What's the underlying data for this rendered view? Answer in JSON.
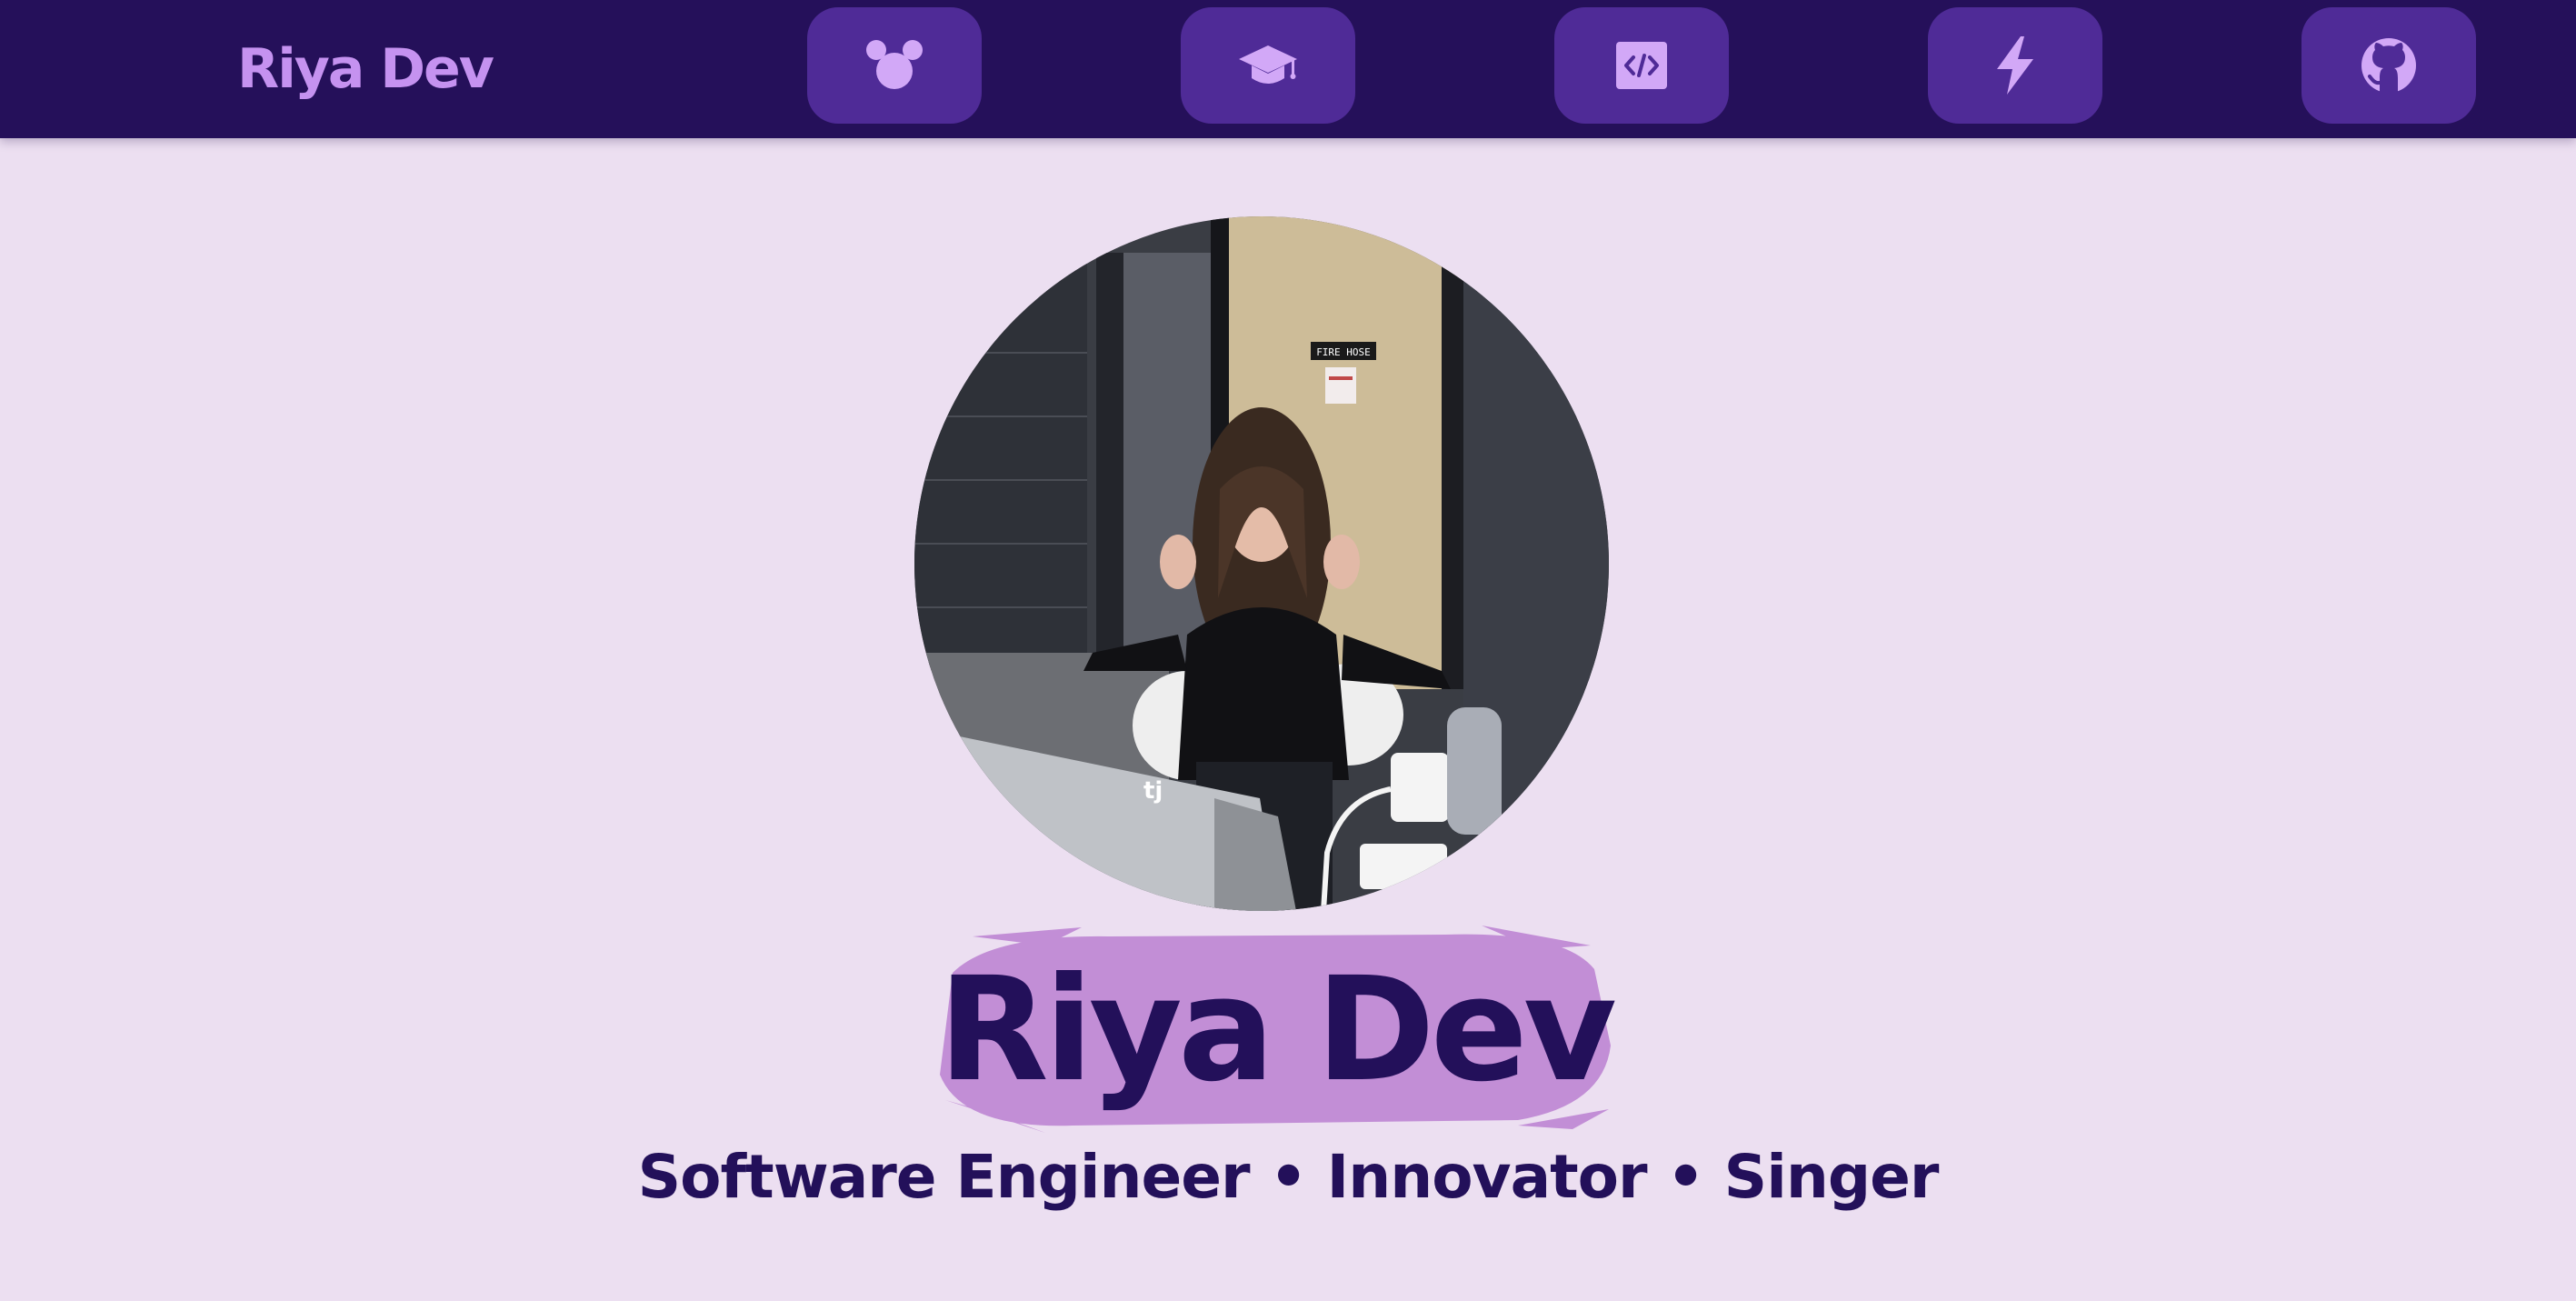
{
  "nav": {
    "brand": "Riya Dev",
    "buttons": [
      {
        "icon": "mouse-ears-icon"
      },
      {
        "icon": "graduation-cap-icon"
      },
      {
        "icon": "code-file-icon"
      },
      {
        "icon": "lightning-icon"
      },
      {
        "icon": "github-icon"
      }
    ]
  },
  "hero": {
    "name": "Riya Dev",
    "tagline": "Software Engineer • Innovator • Singer",
    "photo_sign_text": "FIRE HOSE",
    "laptop_sticker_text": "tj"
  },
  "colors": {
    "navbar_bg": "#25105A",
    "nav_button_bg": "#4F2B97",
    "brand_text": "#C592F0",
    "icon_color": "#D2A8F7",
    "page_bg": "#ECDFF1",
    "heading_text": "#23105A",
    "brush_highlight": "#C28ED6"
  }
}
